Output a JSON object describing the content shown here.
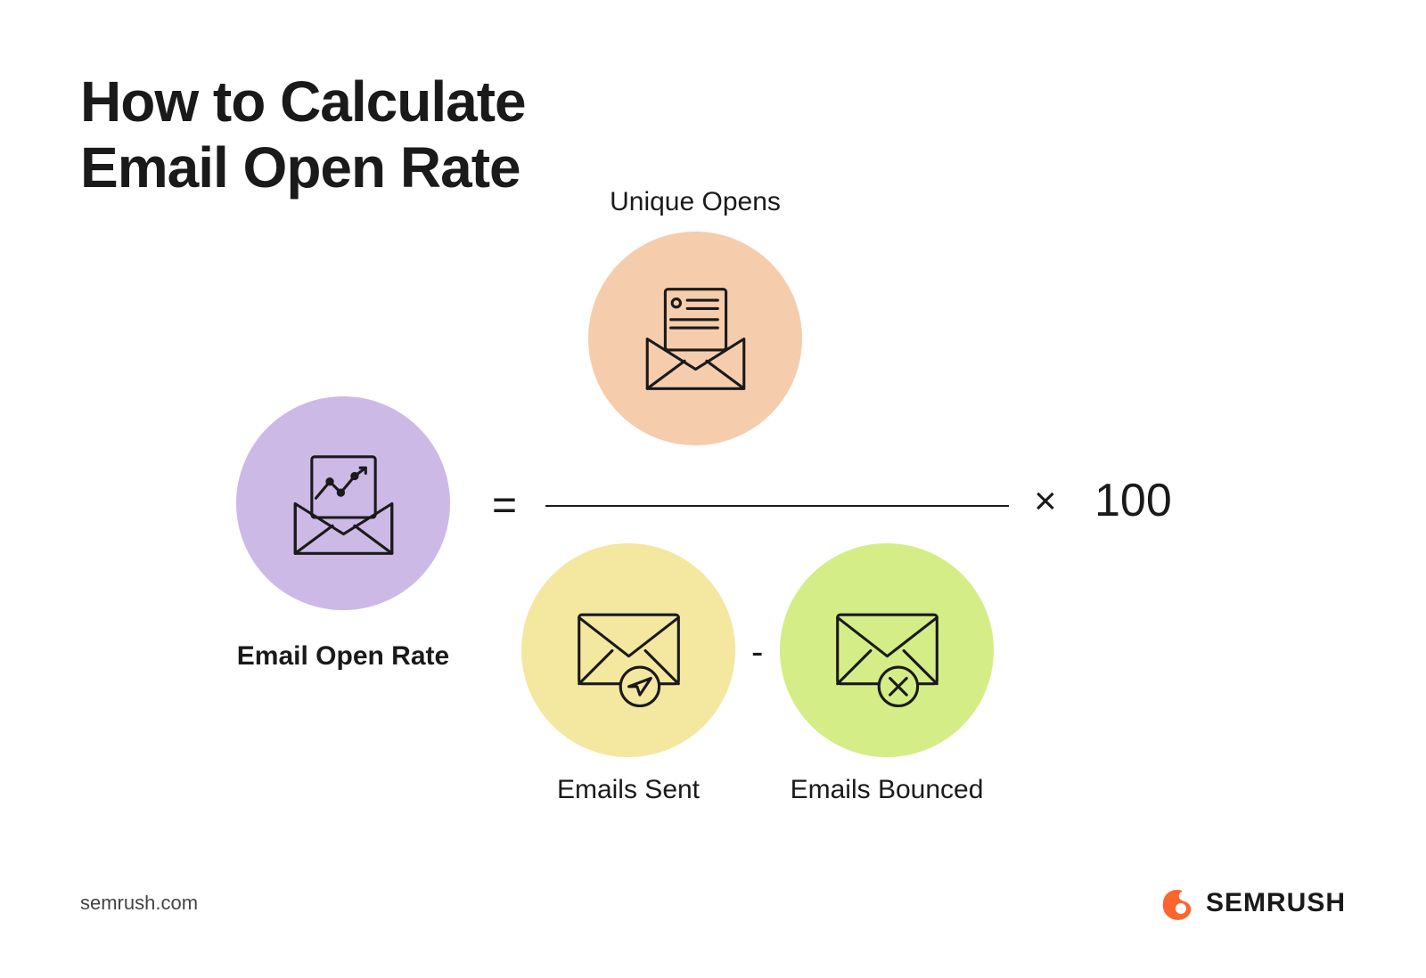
{
  "title_line1": "How to Calculate",
  "title_line2": "Email Open Rate",
  "formula": {
    "lhs_label": "Email Open Rate",
    "numerator_label": "Unique Opens",
    "denominator1_label": "Emails Sent",
    "denominator2_label": "Emails Bounced",
    "equals": "=",
    "minus": "-",
    "times": "×",
    "constant": "100"
  },
  "colors": {
    "lhs_circle": "#cdb9e6",
    "numerator_circle": "#f5cdad",
    "denom1_circle": "#f4e7a0",
    "denom2_circle": "#d5ed86",
    "brand_orange": "#ff642d"
  },
  "footer": {
    "url": "semrush.com",
    "brand": "SEMRUSH"
  }
}
